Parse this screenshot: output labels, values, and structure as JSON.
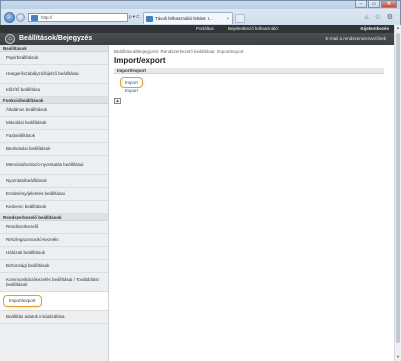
{
  "browser": {
    "address": "http://",
    "address_tools": "ρ ▾ C",
    "tab_title": "Távoli felhasználói felület: I...",
    "tab_close": "×",
    "window_buttons": [
      "–",
      "▭",
      "✕"
    ],
    "toolbar_icons": "⌂ ☆ ⚙"
  },
  "header": {
    "top_links": [
      "Portáltus",
      "Bejelentkező felhasználó:",
      "Kijelentkezés"
    ],
    "title": "Beállítások/Bejegyzés",
    "mail_link": "E-mail a rendszerszervezőnek"
  },
  "sidebar": {
    "sections": [
      {
        "title": "Beállítások",
        "items": [
          {
            "label": "Papírbeállítások"
          },
          {
            "label": "Hangerőszabályzó/kijelző beállításai"
          },
          {
            "label": "Időzítő beállítása"
          }
        ]
      },
      {
        "title": "Funkcióbeállítások",
        "items": [
          {
            "label": "Általános beállítások"
          },
          {
            "label": "Másolási beállítások"
          },
          {
            "label": "Faxbeállítások"
          },
          {
            "label": "Beolvasási beállítások"
          },
          {
            "label": "Memóriahordozó-nyomtatás beállításai"
          },
          {
            "label": "Nyomtatóbeállítások"
          },
          {
            "label": "Eredmény/jelentés beállításai"
          },
          {
            "label": "Kedvenc beállítások"
          }
        ]
      },
      {
        "title": "Rendszerkezelő beállítások",
        "items": [
          {
            "label": "Rendszerkezelő"
          },
          {
            "label": "Részlegazonosító-kezelés"
          },
          {
            "label": "Hálózati beállítások"
          },
          {
            "label": "Biztonsági beállítások"
          },
          {
            "label": "Kommunikációkezelés beállításai / Továbbítási beállítások"
          },
          {
            "label": "Import/export"
          },
          {
            "label": "Beállítás adatok inicializálása"
          }
        ]
      }
    ]
  },
  "main": {
    "breadcrumb": "Beállítások/Bejegyzés: Rendszerkezelő beállításai: Import/export",
    "title": "Import/export",
    "section_title": "Import/export",
    "links": {
      "import": "Import",
      "export": "Export"
    },
    "top_button": "▲"
  }
}
